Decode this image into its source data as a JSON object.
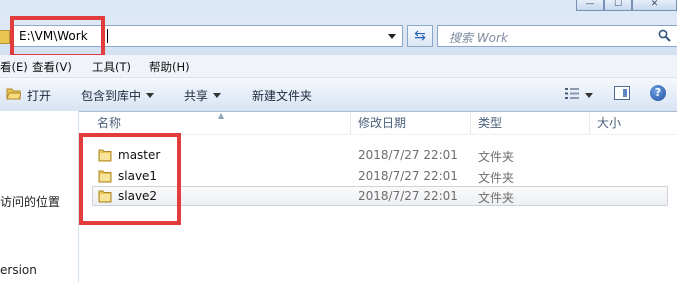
{
  "address": {
    "path": "E:\\VM\\Work"
  },
  "search": {
    "placeholder": "搜索 Work"
  },
  "window": {
    "minimize": "—",
    "maximize": "☐",
    "close": "✕"
  },
  "menu": [
    "看(E)",
    "查看(V)",
    "工具(T)",
    "帮助(H)"
  ],
  "toolbar": {
    "open": "打开",
    "include_in_library": "包含到库中",
    "share": "共享",
    "new_folder": "新建文件夹"
  },
  "nav": {
    "recent_places": "访问的位置",
    "version": "ersion"
  },
  "columns": {
    "name": "名称",
    "modified": "修改日期",
    "type": "类型",
    "size": "大小"
  },
  "files": [
    {
      "name": "master",
      "modified": "2018/7/27 22:01",
      "type": "文件夹"
    },
    {
      "name": "slave1",
      "modified": "2018/7/27 22:01",
      "type": "文件夹"
    },
    {
      "name": "slave2",
      "modified": "2018/7/27 22:01",
      "type": "文件夹"
    }
  ],
  "icons": {
    "folder": "folder-icon",
    "search": "search-icon",
    "refresh": "refresh-icon",
    "help": "help-icon"
  },
  "colors": {
    "highlight_box": "#e23c3c",
    "toolbar_bg": "#dfe9f6",
    "folder": "#e9c450"
  }
}
